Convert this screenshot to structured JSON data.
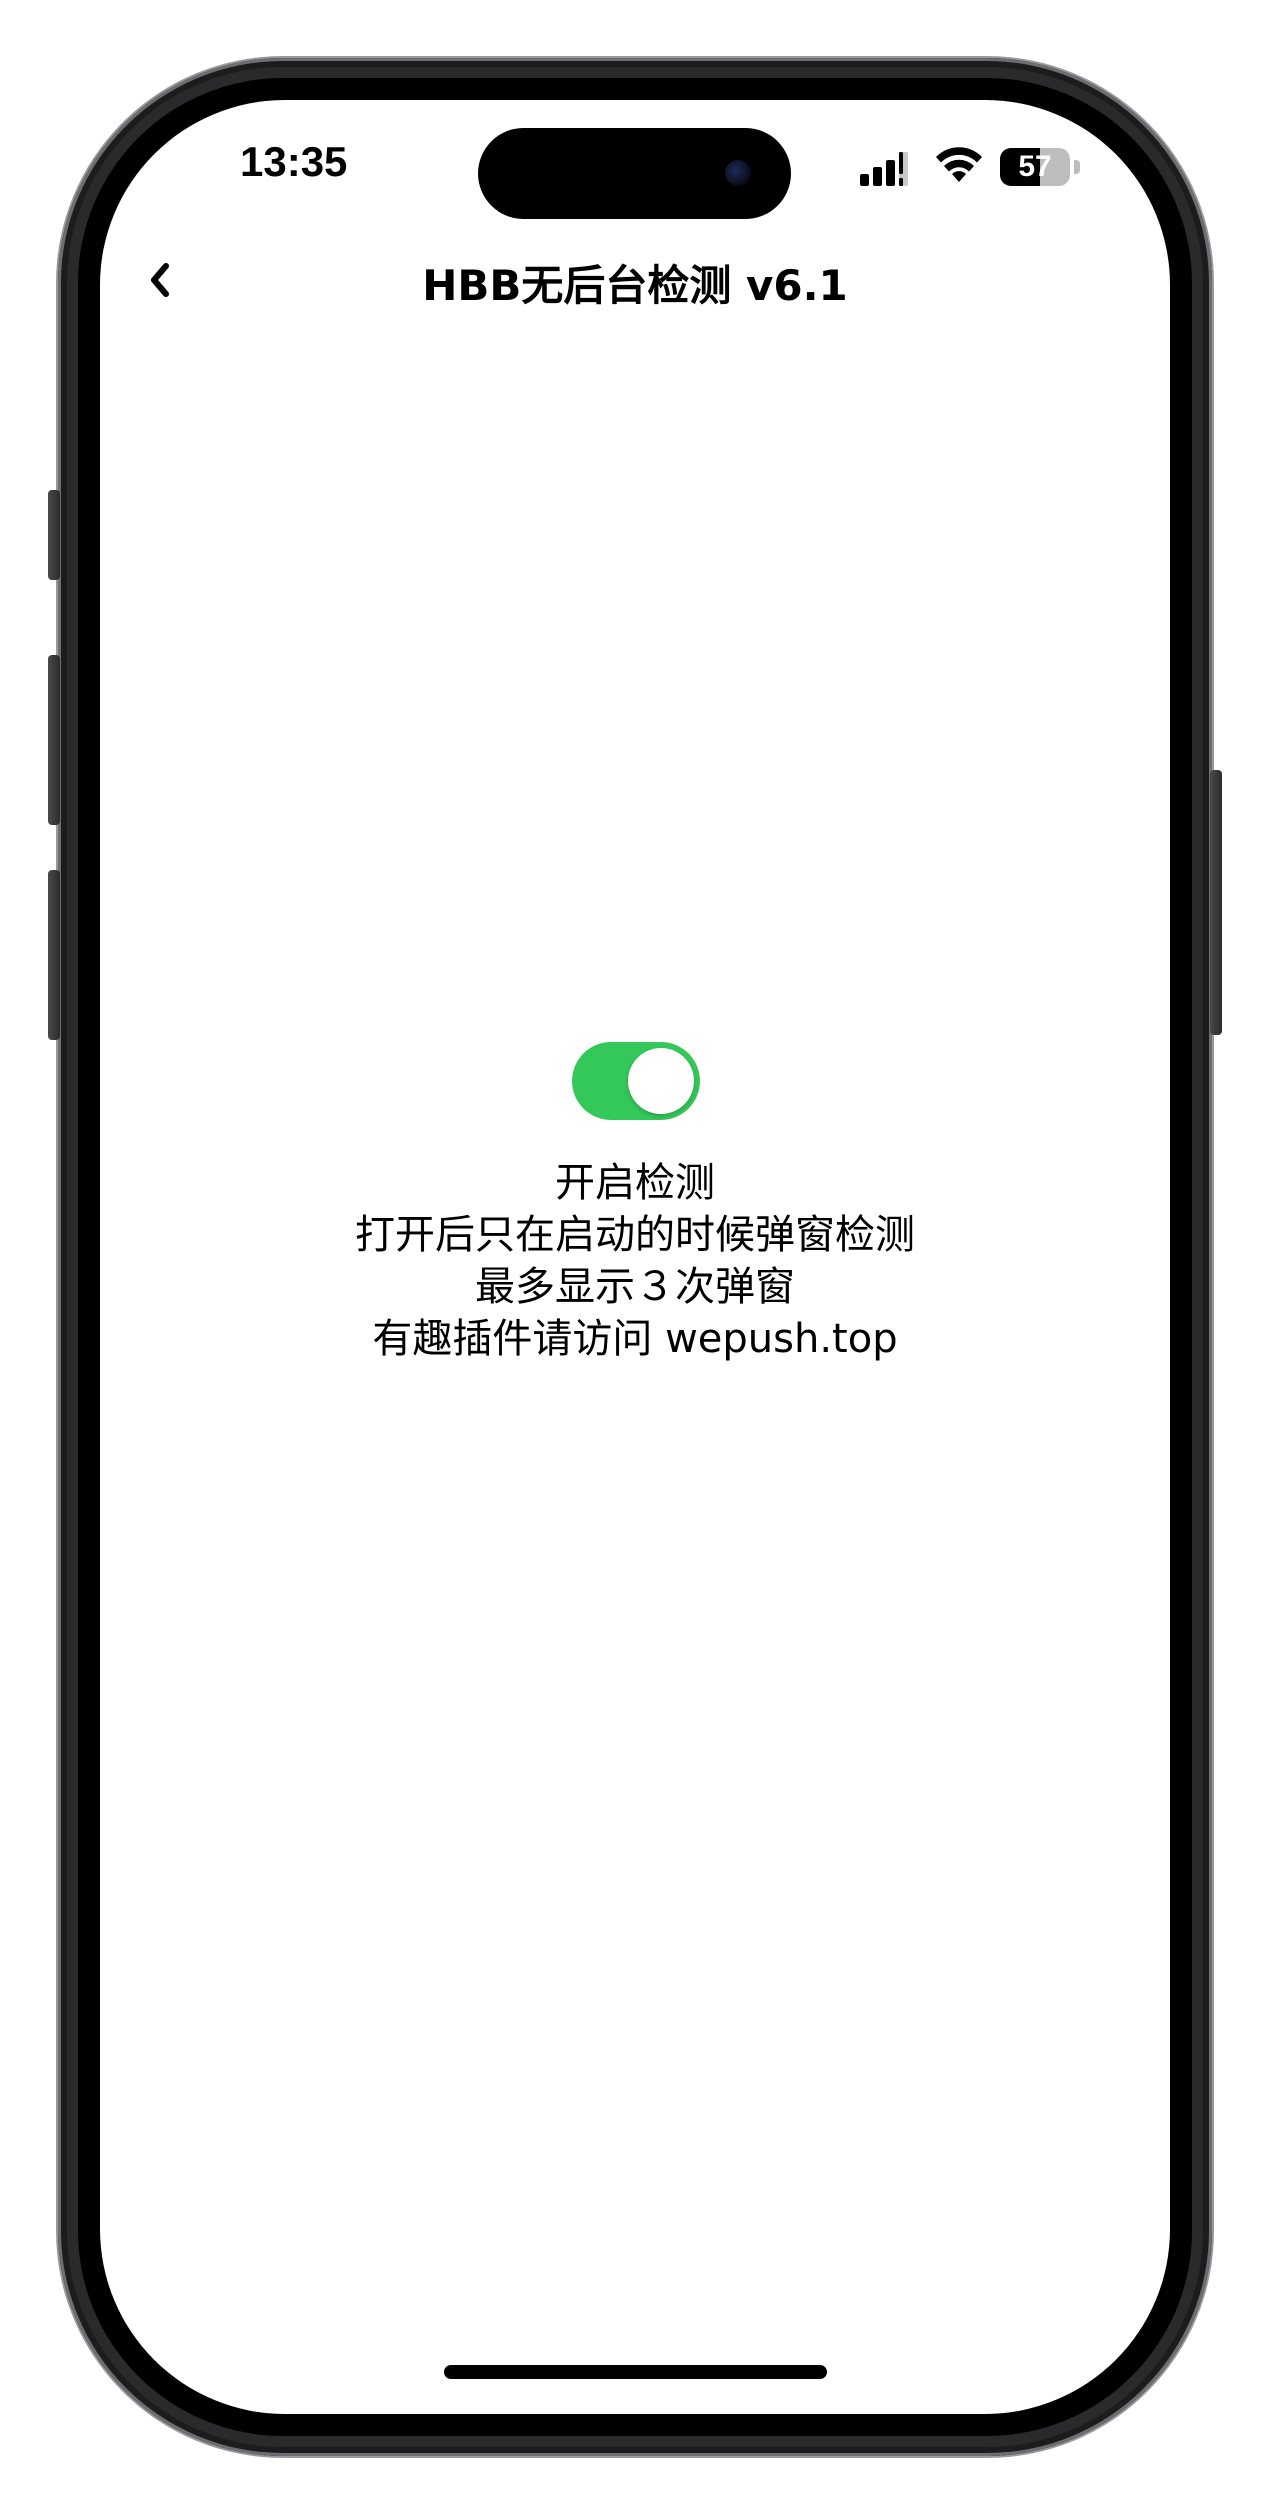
{
  "status_bar": {
    "time": "13:35",
    "battery_level": "57",
    "icons": [
      "signal-icon",
      "wifi-icon",
      "battery-icon"
    ]
  },
  "nav": {
    "title": "HBB无后台检测 v6.1",
    "back_icon": "chevron-left-icon"
  },
  "toggle": {
    "state": "on",
    "color": "#34c759"
  },
  "description": {
    "lines": [
      "开启检测",
      "打开后只在启动的时候弹窗检测",
      "最多显示３次弹窗",
      "有趣插件请访问 wepush.top"
    ]
  }
}
